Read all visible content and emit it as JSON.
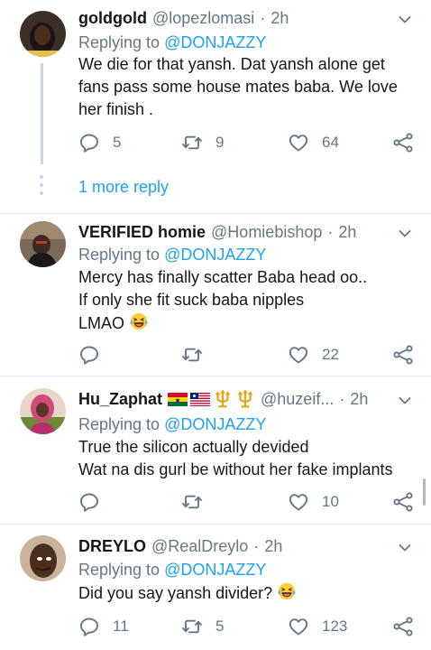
{
  "more_replies": "1 more reply",
  "replying_prefix": "Replying to ",
  "accent_color": "#1da1f2",
  "muted_color": "#657786",
  "tweets": [
    {
      "name": "goldgold",
      "handle": "@lopezlomasi",
      "dot": "·",
      "time": "2h",
      "reply_to": "@DONJAZZY",
      "lines": [
        "We die for that yansh. Dat yansh alone get",
        "fans pass some house mates baba. We love",
        "her finish ."
      ],
      "replies": "5",
      "retweets": "9",
      "likes": "64"
    },
    {
      "name": "VERIFIED homie",
      "handle": "@Homiebishop",
      "dot": "·",
      "time": "2h",
      "reply_to": "@DONJAZZY",
      "lines": [
        "Mercy has finally scatter Baba head oo..",
        "If only she fit suck baba nipples",
        "LMAO"
      ],
      "emoji": "face-with-tears-of-joy",
      "replies": "",
      "retweets": "",
      "likes": "22"
    },
    {
      "name": "Hu_Zaphat",
      "flags": [
        "ghana-flag",
        "liberia-flag",
        "trident-emoji",
        "trident-emoji"
      ],
      "handle": "@huzeif...",
      "dot": "·",
      "time": "2h",
      "reply_to": "@DONJAZZY",
      "lines": [
        "True the silicon actually devided",
        "Wat na dis gurl be without her fake implants"
      ],
      "replies": "",
      "retweets": "",
      "likes": "10"
    },
    {
      "name": "DREYLO",
      "handle": "@RealDreylo",
      "dot": "·",
      "time": "2h",
      "reply_to": "@DONJAZZY",
      "lines": [
        "Did you say yansh divider?"
      ],
      "emoji": "face-with-tears-of-joy",
      "replies": "11",
      "retweets": "5",
      "likes": "123"
    }
  ]
}
